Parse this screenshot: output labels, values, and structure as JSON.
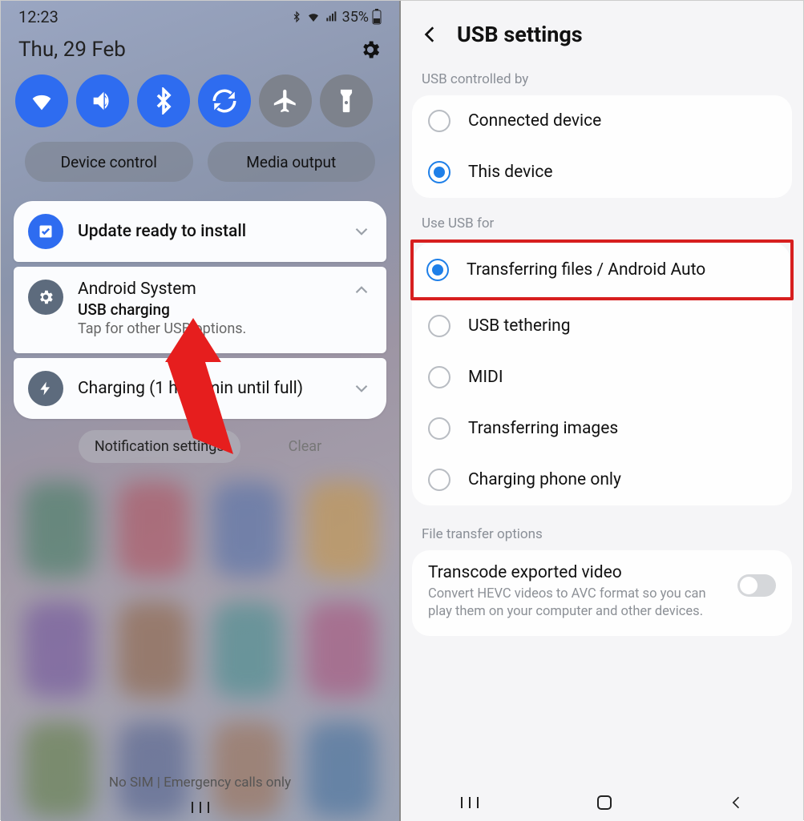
{
  "left": {
    "time": "12:23",
    "battery": "35%",
    "date": "Thu, 29 Feb",
    "pills": {
      "device_control": "Device control",
      "media_output": "Media output"
    },
    "notif_update": "Update ready to install",
    "notif_sys": {
      "app": "Android System",
      "title": "USB charging",
      "sub": "Tap for other USB options."
    },
    "notif_charging": "Charging (1 h 27 min until full)",
    "footer": {
      "settings": "Notification settings",
      "clear": "Clear"
    },
    "no_sim": "No SIM | Emergency calls only"
  },
  "right": {
    "title": "USB settings",
    "sec1": "USB controlled by",
    "opt_connected": "Connected device",
    "opt_this": "This device",
    "sec2": "Use USB for",
    "opt_transfer": "Transferring files / Android Auto",
    "opt_tether": "USB tethering",
    "opt_midi": "MIDI",
    "opt_images": "Transferring images",
    "opt_charging": "Charging phone only",
    "sec3": "File transfer options",
    "transcode_title": "Transcode exported video",
    "transcode_sub": "Convert HEVC videos to AVC format so you can play them on your computer and other devices."
  }
}
